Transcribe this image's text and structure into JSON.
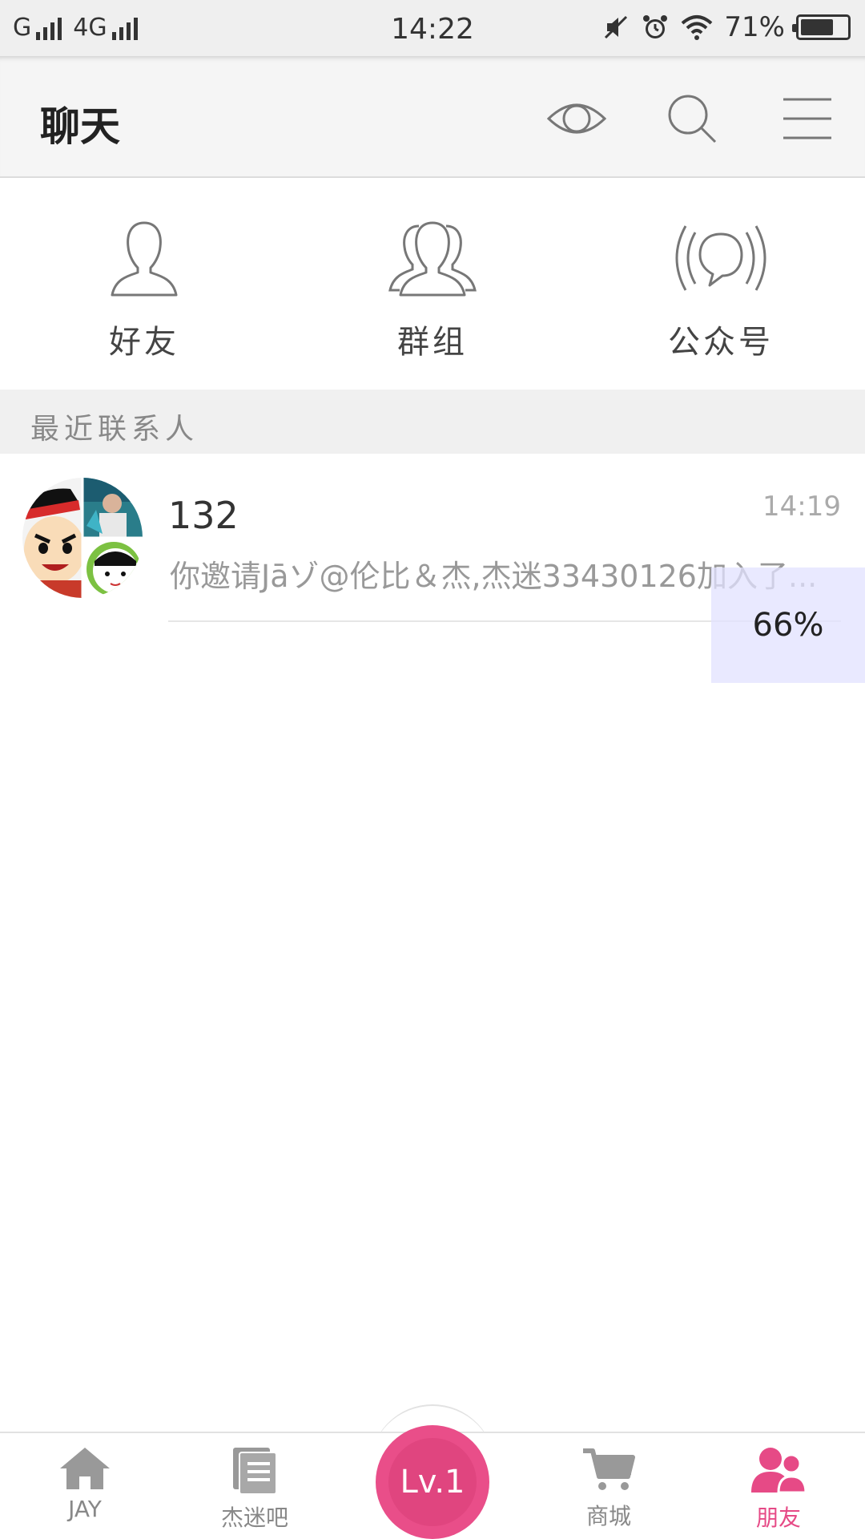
{
  "status_bar": {
    "network1": "G",
    "network2": "4G",
    "time": "14:22",
    "battery": "71%",
    "battery_level": 0.71
  },
  "header": {
    "title": "聊天"
  },
  "quick_actions": [
    {
      "label": "好友",
      "icon": "person-icon"
    },
    {
      "label": "群组",
      "icon": "group-icon"
    },
    {
      "label": "公众号",
      "icon": "broadcast-bubble-icon"
    }
  ],
  "recent": {
    "section_title": "最近联系人",
    "conversations": [
      {
        "name": "132",
        "time": "14:19",
        "message": "你邀请Jāゾ@伦比＆杰,杰迷33430126加入了..."
      }
    ]
  },
  "progress_overlay": {
    "text": "66%"
  },
  "bottom_nav": {
    "items": [
      {
        "label": "JAY",
        "icon": "home-icon"
      },
      {
        "label": "杰迷吧",
        "icon": "document-icon"
      },
      {
        "label": "商城",
        "icon": "cart-icon"
      },
      {
        "label": "朋友",
        "icon": "friends-icon"
      }
    ],
    "center_label": "Lv.1",
    "active_color": "#e64a86",
    "accent_color": "#e94e89"
  }
}
